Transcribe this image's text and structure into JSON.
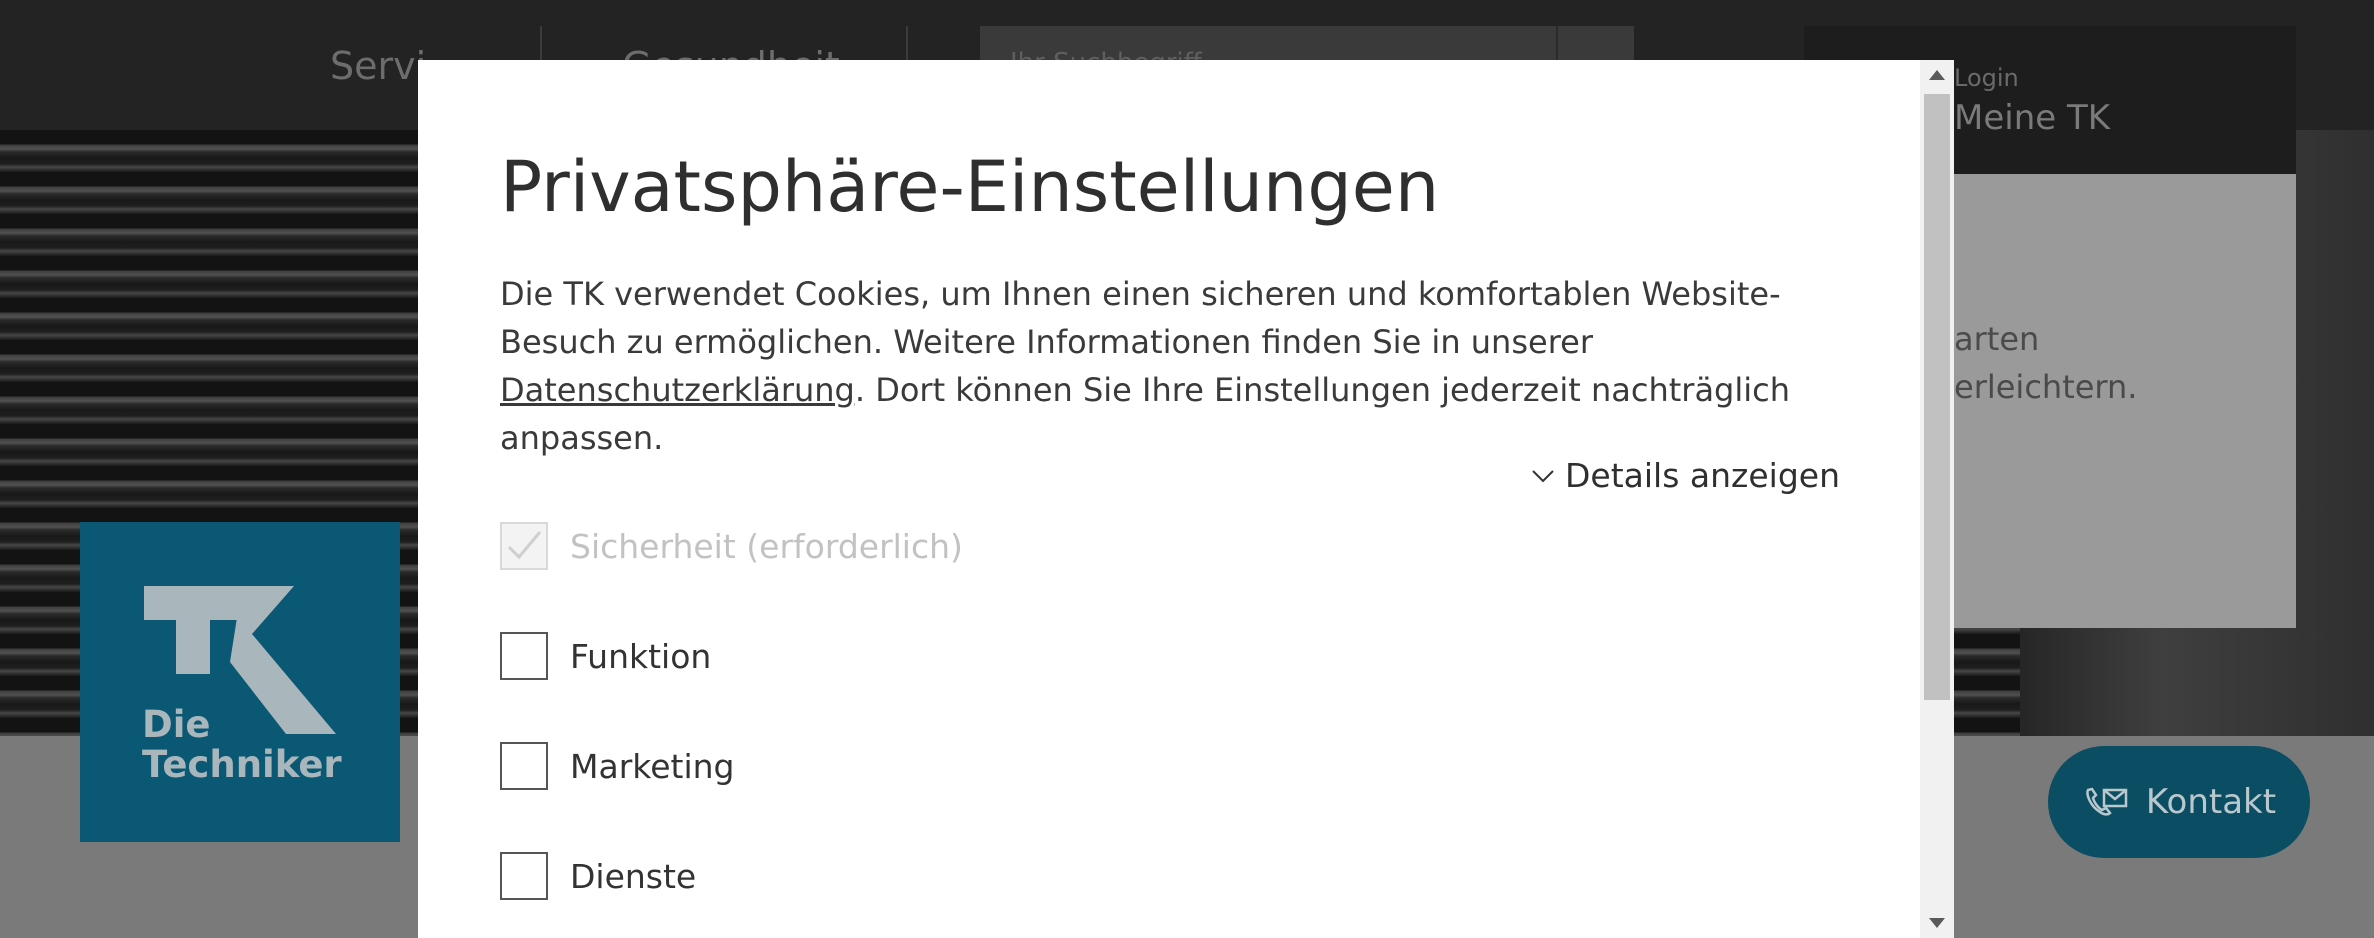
{
  "header": {
    "nav": [
      "Servi",
      "Gesundheit"
    ],
    "search_placeholder": "Ihr Suchbegriff",
    "login_label": "Login",
    "login_title": "Meine TK"
  },
  "info_panel": {
    "lines": [
      "arten",
      "erleichtern."
    ]
  },
  "logo": {
    "line1": "Die",
    "line2": "Techniker"
  },
  "kontakt": {
    "label": "Kontakt"
  },
  "modal": {
    "title": "Privatsphäre-Einstellungen",
    "text_before_link": "Die TK verwendet Cookies, um Ihnen einen sicheren und komfortablen Website-Besuch zu ermöglichen. Weitere Informationen finden Sie in unserer ",
    "link": "Datenschutzerklärung",
    "text_after_link": ". Dort können Sie Ihre Einstellungen jederzeit nachträglich anpassen.",
    "details_label": "Details anzeigen",
    "options": [
      {
        "label": "Sicherheit (erforderlich)",
        "checked": true,
        "disabled": true
      },
      {
        "label": "Funktion",
        "checked": false,
        "disabled": false
      },
      {
        "label": "Marketing",
        "checked": false,
        "disabled": false
      },
      {
        "label": "Dienste",
        "checked": false,
        "disabled": false
      }
    ]
  },
  "colors": {
    "brand": "#0b5875",
    "overlay": "#7a7a7a",
    "modal_bg": "#ffffff"
  }
}
